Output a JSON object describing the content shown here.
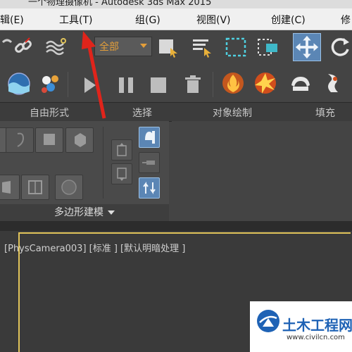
{
  "titlebar": {
    "partial_title": "一个物理摄像机 - Autodesk 3ds Max 2015"
  },
  "menubar": {
    "items": [
      {
        "label": "辑(E)"
      },
      {
        "label": "工具(T)"
      },
      {
        "label": "组(G)"
      },
      {
        "label": "视图(V)"
      },
      {
        "label": "创建(C)"
      },
      {
        "label": "修"
      }
    ]
  },
  "toolbar": {
    "selection_filter": "全部"
  },
  "ribbon": {
    "tabs": [
      {
        "label": "自由形式"
      },
      {
        "label": "选择"
      },
      {
        "label": "对象绘制"
      },
      {
        "label": "填充"
      }
    ],
    "panel_title": "多边形建模"
  },
  "viewport": {
    "label": "[PhysCamera003] [标准 ] [默认明暗处理 ]"
  },
  "watermark": {
    "title": "土木工程网",
    "url": "www.civilcn.com"
  },
  "colors": {
    "accent_yellow": "#e1c45a",
    "dropdown_text": "#e39e3a",
    "annotation_red": "#e0241b",
    "active_blue": "#5b86b5"
  }
}
